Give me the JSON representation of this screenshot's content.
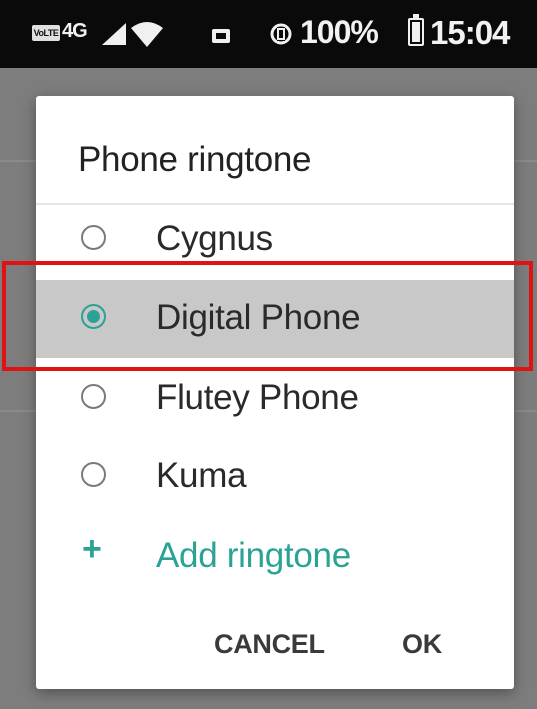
{
  "status_bar": {
    "volte_label": "VoLTE",
    "network_label": "4G",
    "battery_text": "100%",
    "time": "15:04",
    "icons": [
      "signal-icon",
      "wifi-icon",
      "notification-icon",
      "rotate-icon",
      "battery-icon"
    ]
  },
  "dialog": {
    "title": "Phone ringtone",
    "options": [
      {
        "label": "Cygnus",
        "selected": false
      },
      {
        "label": "Digital Phone",
        "selected": true
      },
      {
        "label": "Flutey Phone",
        "selected": false
      },
      {
        "label": "Kuma",
        "selected": false
      }
    ],
    "add_icon": "+",
    "add_label": "Add ringtone",
    "cancel_label": "CANCEL",
    "ok_label": "OK"
  },
  "colors": {
    "accent": "#2aa394",
    "highlight": "#e01212",
    "selected_row": "#c8c8c8"
  }
}
